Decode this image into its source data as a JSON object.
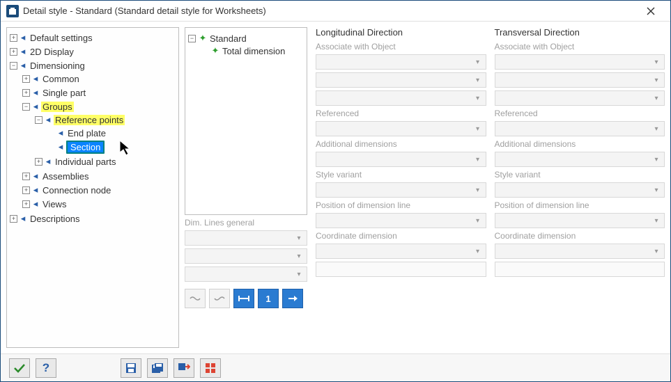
{
  "window": {
    "title": "Detail style - Standard (Standard detail style for Worksheets)"
  },
  "tree": {
    "default_settings": "Default settings",
    "display_2d": "2D Display",
    "dimensioning": "Dimensioning",
    "common": "Common",
    "single_part": "Single part",
    "groups": "Groups",
    "reference_points": "Reference points",
    "end_plate": "End plate",
    "section": "Section",
    "individual_parts": "Individual parts",
    "assemblies": "Assemblies",
    "connection_node": "Connection node",
    "views": "Views",
    "descriptions": "Descriptions"
  },
  "subtree": {
    "standard": "Standard",
    "total_dimension": "Total dimension"
  },
  "dimlines": {
    "heading": "Dim. Lines general"
  },
  "longitudinal": {
    "heading": "Longitudinal Direction",
    "associate": "Associate with Object",
    "referenced": "Referenced",
    "additional": "Additional dimensions",
    "style_variant": "Style variant",
    "position": "Position of dimension line",
    "coordinate": "Coordinate dimension"
  },
  "transversal": {
    "heading": "Transversal Direction",
    "associate": "Associate with Object",
    "referenced": "Referenced",
    "additional": "Additional dimensions",
    "style_variant": "Style variant",
    "position": "Position of dimension line",
    "coordinate": "Coordinate dimension"
  },
  "toolbar": {
    "check": "✔",
    "help": "?",
    "save": "💾",
    "saveas": "💾",
    "link": "⇄",
    "tiles": "▦"
  }
}
